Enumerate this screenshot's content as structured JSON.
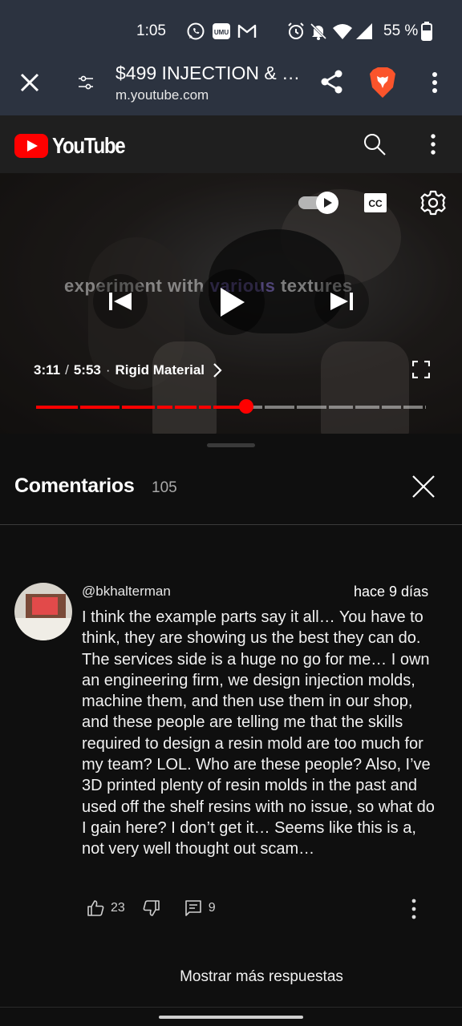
{
  "status_bar": {
    "time": "1:05",
    "battery_percent": "55 %",
    "icons": [
      "whatsapp-icon",
      "umu-icon",
      "gmail-icon",
      "alarm-icon",
      "notifications-off-icon",
      "wifi-icon",
      "signal-icon",
      "battery-icon"
    ]
  },
  "browser": {
    "title": "$499 INJECTION & …",
    "url": "m.youtube.com",
    "icons": [
      "close-icon",
      "tune-icon",
      "share-icon",
      "brave-icon",
      "more-vert-icon"
    ]
  },
  "youtube_header": {
    "logo_text": "YouTube",
    "icons": [
      "search-icon",
      "more-vert-icon"
    ]
  },
  "player": {
    "overlay_text_start": "experiment with ",
    "overlay_text_highlight": "various",
    "overlay_text_end": " textures",
    "current_time": "3:11",
    "separator": "/",
    "duration": "5:53",
    "chapter_separator": "·",
    "chapter": "Rigid Material",
    "progress_fraction": 0.54,
    "accent_color": "#ff0000",
    "icons": [
      "autoplay-toggle-icon",
      "cc-icon",
      "settings-icon",
      "previous-icon",
      "play-icon",
      "next-icon",
      "chevron-right-icon",
      "fullscreen-icon"
    ]
  },
  "comments": {
    "title": "Comentarios",
    "count": "105",
    "items": [
      {
        "author": "@bkhalterman",
        "time": "hace 9 días",
        "text": "I think the example parts say it all… You have to think, they are showing us the best they can do. The services side is a huge no go for me… I own an engineering firm, we design injection molds, machine them, and then use them in our shop, and these people are telling me that the skills required to design a resin mold are too much for my team? LOL. Who are these people? Also, I’ve 3D printed plenty of resin molds in the past and used off the shelf resins with no issue, so what do I gain here? I don’t get it… Seems like this is a, not very well thought out scam…",
        "likes": "23",
        "replies": "9"
      }
    ],
    "show_more_label": "Mostrar más respuestas"
  }
}
